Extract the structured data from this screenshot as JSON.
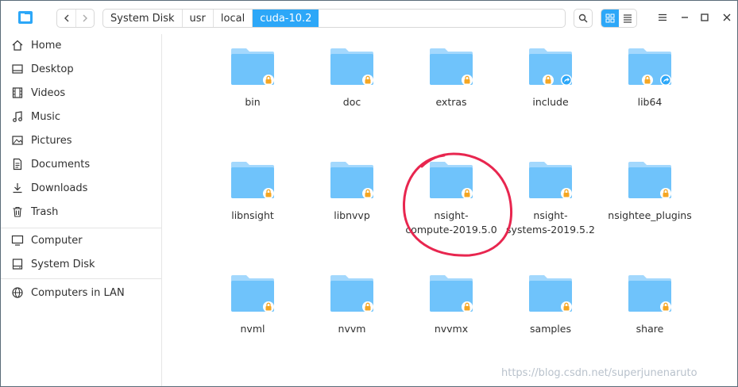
{
  "titlebar": {
    "breadcrumbs": [
      "System Disk",
      "usr",
      "local",
      "cuda-10.2"
    ],
    "active_crumb": "cuda-10.2"
  },
  "sidebar": {
    "items": [
      {
        "label": "Home",
        "icon": "home-icon"
      },
      {
        "label": "Desktop",
        "icon": "desktop-icon"
      },
      {
        "label": "Videos",
        "icon": "film-icon"
      },
      {
        "label": "Music",
        "icon": "music-note-icon"
      },
      {
        "label": "Pictures",
        "icon": "picture-icon"
      },
      {
        "label": "Documents",
        "icon": "document-icon"
      },
      {
        "label": "Downloads",
        "icon": "download-icon"
      },
      {
        "label": "Trash",
        "icon": "trash-icon"
      },
      {
        "label": "Computer",
        "icon": "monitor-icon"
      },
      {
        "label": "System Disk",
        "icon": "disk-icon"
      },
      {
        "label": "Computers in LAN",
        "icon": "network-icon"
      }
    ]
  },
  "folders": [
    {
      "name": "bin",
      "badge": "lock"
    },
    {
      "name": "doc",
      "badge": "lock"
    },
    {
      "name": "extras",
      "badge": "lock"
    },
    {
      "name": "include",
      "badge": "lock+link"
    },
    {
      "name": "lib64",
      "badge": "lock+link"
    },
    {
      "name": "libnsight",
      "badge": "lock"
    },
    {
      "name": "libnvvp",
      "badge": "lock"
    },
    {
      "name": "nsight-compute-2019.5.0",
      "line1": "nsight-",
      "line2": "compute-2019.5.0",
      "badge": "lock"
    },
    {
      "name": "nsight-systems-2019.5.2",
      "line1": "nsight-",
      "line2": "systems-2019.5.2",
      "badge": "lock"
    },
    {
      "name": "nsightee_plugins",
      "badge": "lock"
    },
    {
      "name": "nvml",
      "badge": "lock"
    },
    {
      "name": "nvvm",
      "badge": "lock"
    },
    {
      "name": "nvvmx",
      "badge": "lock"
    },
    {
      "name": "samples",
      "badge": "lock"
    },
    {
      "name": "share",
      "badge": "lock"
    }
  ],
  "watermark": "https://blog.csdn.net/superjunenaruto",
  "colors": {
    "accent": "#2ca7f8",
    "folder_body": "#6fc3fb",
    "folder_tab": "#a3d8fd",
    "lock_badge": "#f5a623",
    "annotation_circle": "#e8264f"
  }
}
